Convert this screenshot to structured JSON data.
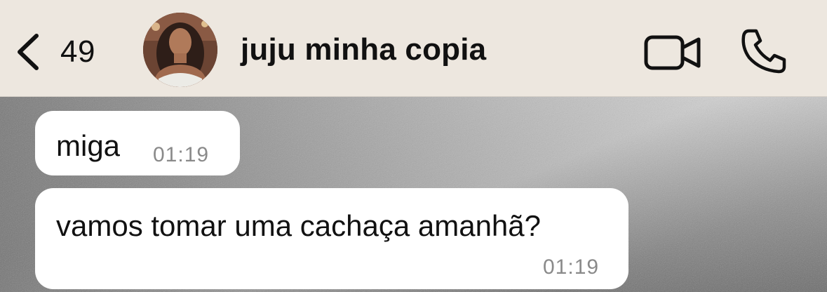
{
  "header": {
    "back_count": "49",
    "contact_name": "juju minha copia",
    "back_icon": "chevron-left-icon",
    "video_icon": "video-camera-icon",
    "call_icon": "phone-icon"
  },
  "messages": [
    {
      "text": "miga",
      "time": "01:19"
    },
    {
      "text": "vamos tomar uma cachaça amanhã?",
      "time": "01:19"
    }
  ],
  "colors": {
    "header_bg": "#ede7df",
    "bubble_bg": "#ffffff",
    "timestamp": "#8a8a8a",
    "text": "#111111"
  }
}
